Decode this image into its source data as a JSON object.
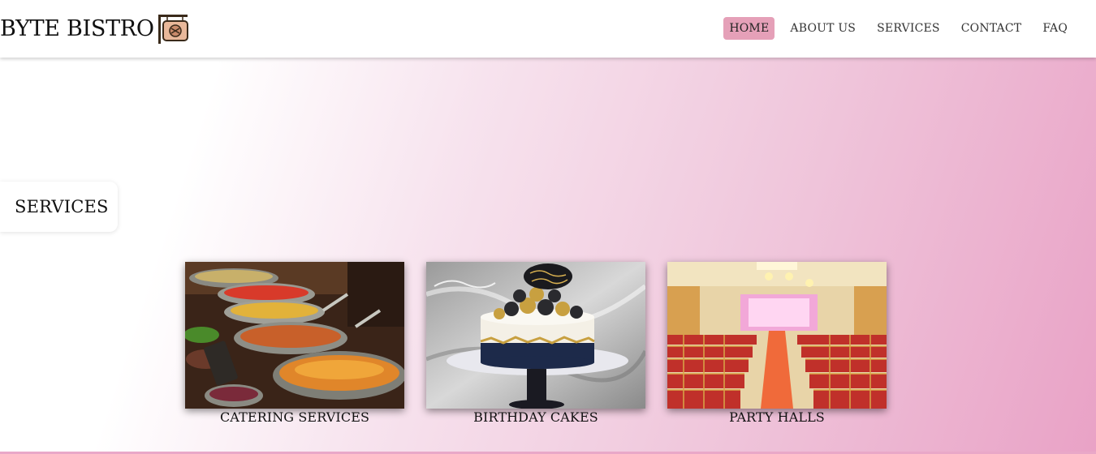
{
  "brand": {
    "name": "BYTE BISTRO",
    "logo_icon": "hanging-sign-icon"
  },
  "nav": {
    "items": [
      {
        "label": "HOME",
        "active": true
      },
      {
        "label": "ABOUT US",
        "active": false
      },
      {
        "label": "SERVICES",
        "active": false
      },
      {
        "label": "CONTACT",
        "active": false
      },
      {
        "label": "FAQ",
        "active": false
      }
    ]
  },
  "colors": {
    "accent_pink": "#e5a0b8",
    "hero_gradient_end": "#e9a2c6"
  },
  "section": {
    "title": "SERVICES"
  },
  "services": [
    {
      "label": "CATERING SERVICES",
      "image": "catering-buffet-image"
    },
    {
      "label": "BIRTHDAY CAKES",
      "image": "birthday-cake-image"
    },
    {
      "label": "PARTY HALLS",
      "image": "party-hall-image"
    }
  ]
}
